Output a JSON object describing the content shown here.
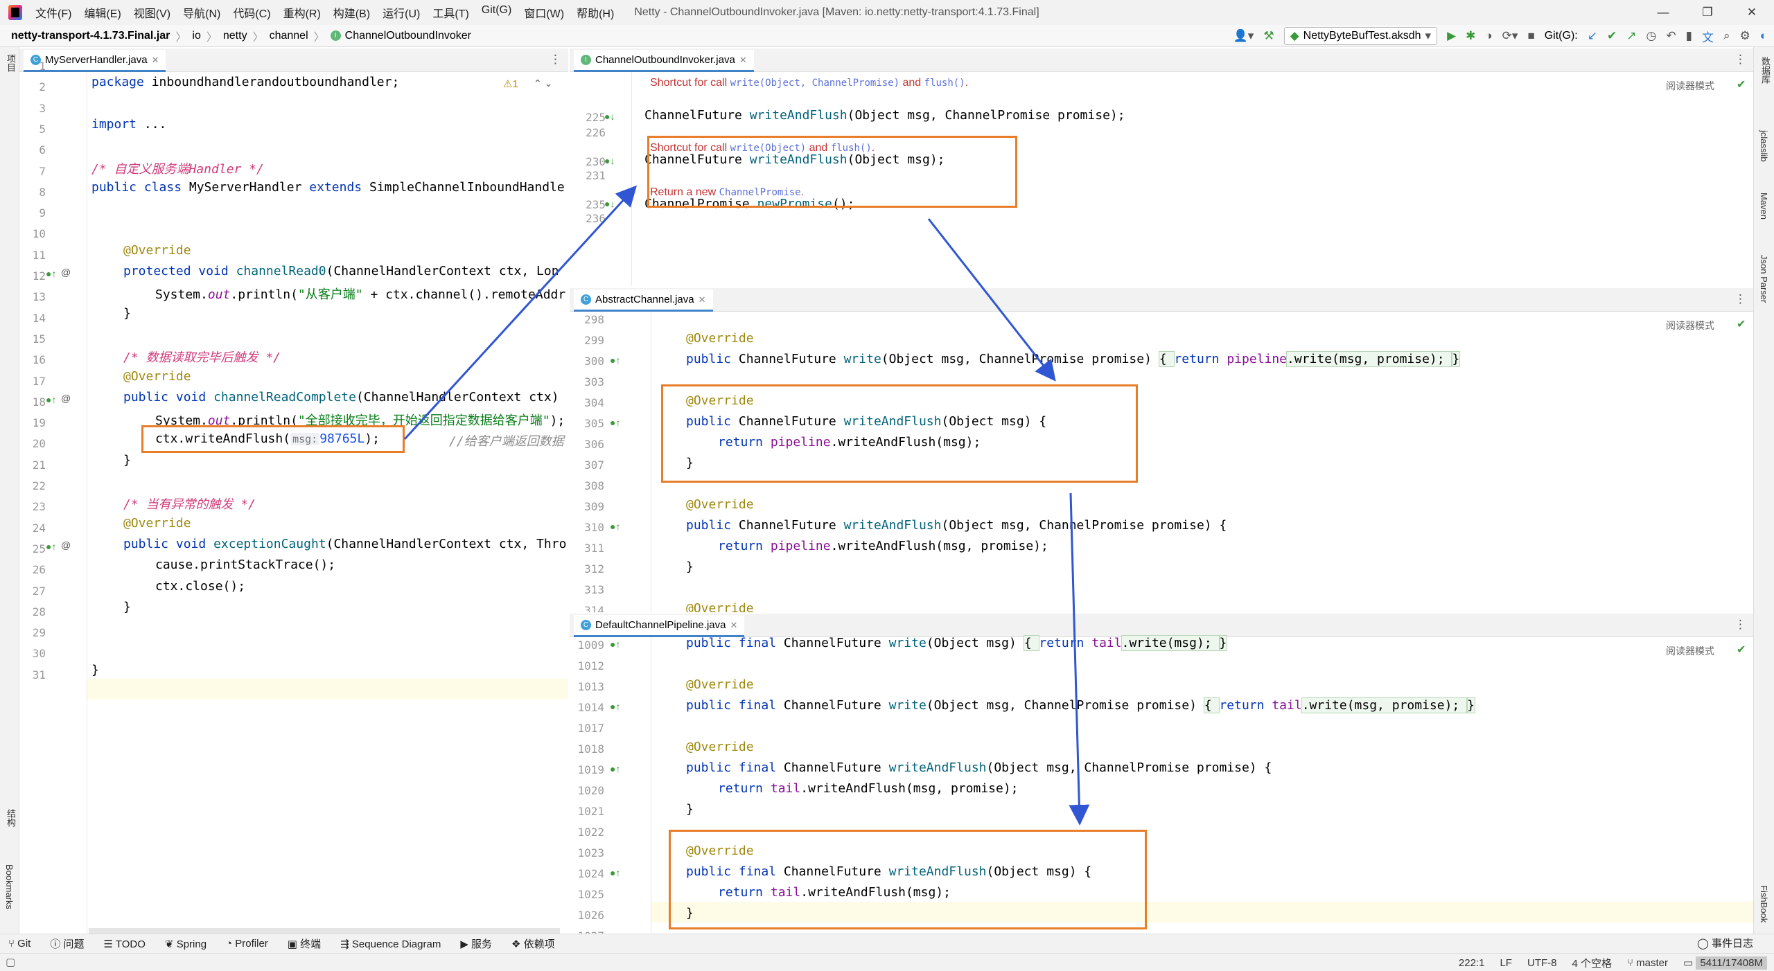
{
  "menus": [
    "文件(F)",
    "编辑(E)",
    "视图(V)",
    "导航(N)",
    "代码(C)",
    "重构(R)",
    "构建(B)",
    "运行(U)",
    "工具(T)",
    "Git(G)",
    "窗口(W)",
    "帮助(H)"
  ],
  "window_title": "Netty - ChannelOutboundInvoker.java [Maven: io.netty:netty-transport:4.1.73.Final]",
  "window_controls": [
    "—",
    "❐",
    "✕"
  ],
  "breadcrumbs": [
    "netty-transport-4.1.73.Final.jar",
    "io",
    "netty",
    "channel",
    "ChannelOutboundInvoker"
  ],
  "run_config": "NettyByteBufTest.aksdh",
  "git_label": "Git(G):",
  "left_tools": [
    "项目",
    "结构",
    "Bookmarks"
  ],
  "right_tools": [
    "数据库",
    "jclasslib",
    "Maven",
    "Json Parser",
    "FishBook"
  ],
  "reader_mode": "阅读器模式",
  "left_editor": {
    "tab": "MyServerHandler.java",
    "warning": "⚠1",
    "lines": [
      "1",
      "2",
      "3",
      "5",
      "6",
      "7",
      "8",
      "9",
      "10",
      "11",
      "12",
      "13",
      "14",
      "15",
      "16",
      "17",
      "18",
      "19",
      "20",
      "21",
      "22",
      "23",
      "24",
      "25",
      "26",
      "27",
      "28",
      "29",
      "30",
      "31"
    ],
    "code": {
      "l1_kw": "package",
      "l1_rest": " inboundhandlerandoutboundhandler;",
      "l3_kw": "import",
      "l3_rest": " ...",
      "l6": "/* 自定义服务端Handler */",
      "l7_a": "public class",
      "l7_b": " MyServerHandler ",
      "l7_c": "extends",
      "l7_d": " SimpleChannelInboundHandle",
      "override": "@Override",
      "l11_a": "protected void",
      "l11_b": "channelRead0",
      "l11_c": "(ChannelHandlerContext ctx, Lon",
      "l12_a": "System.",
      "l12_b": "out",
      "l12_c": ".println(",
      "l12_d": "\"从客户端\"",
      "l12_e": " + ctx.channel().remoteAddr",
      "l15": "/* 数据读取完毕后触发 */",
      "l17_a": "public void",
      "l17_b": "channelReadComplete",
      "l17_c": "(ChannelHandlerContext ctx)",
      "l18_d": "\"全部接收完毕，开始返回指定数据给客户端\"",
      "l18_e": ");",
      "l19_a": "ctx.writeAndFlush(",
      "l19_hint": "msg:",
      "l19_val": "98765L",
      "l19_b": ");",
      "l19_cm": "//给客户端返回数据",
      "brace_close": "}",
      "l22": "/* 当有异常的触发 */",
      "l24_a": "public void",
      "l24_b": "exceptionCaught",
      "l24_c": "(ChannelHandlerContext ctx, Thro",
      "l25": "cause.printStackTrace();",
      "l26": "ctx.close();"
    }
  },
  "top_editor": {
    "tab": "ChannelOutboundInvoker.java",
    "lines": [
      "225",
      "226",
      "230",
      "231",
      "235",
      "236"
    ],
    "doc1_a": "Shortcut for call ",
    "doc1_b": "write(Object, ChannelPromise)",
    "doc1_c": " and ",
    "doc1_d": "flush()",
    "doc1_e": ".",
    "m225_a": "ChannelFuture ",
    "m225_b": "writeAndFlush",
    "m225_c": "(Object msg, ChannelPromise promise);",
    "doc2_a": "Shortcut for call ",
    "doc2_b": "write(Object)",
    "doc2_c": " and ",
    "doc2_d": "flush()",
    "doc2_e": ".",
    "m230_c": "(Object msg);",
    "doc3_a": "Return a new ",
    "doc3_b": "ChannelPromise",
    "doc3_c": ".",
    "m235_a": "ChannelPromise ",
    "m235_b": "newPromise",
    "m235_c": "();"
  },
  "mid_editor": {
    "tab": "AbstractChannel.java",
    "lines": [
      "298",
      "299",
      "300",
      "303",
      "304",
      "305",
      "306",
      "307",
      "308",
      "309",
      "310",
      "311",
      "312",
      "313",
      "314"
    ],
    "override": "@Override",
    "pubcf": "public",
    "cf": " ChannelFuture ",
    "write": "write",
    "waf": "writeAndFlush",
    "ret": "return",
    "pipeline": "pipeline",
    "l300_c": "(Object msg, ChannelPromise promise) ",
    "l300_d": "{ ",
    "l300_e": ".write(msg, promise); ",
    "l300_f": "}",
    "l305_c": "(Object msg) {",
    "l306_c": ".writeAndFlush(msg);",
    "close": "}",
    "l310_c": "(Object msg, ChannelPromise promise) {",
    "l311_c": ".writeAndFlush(msg, promise);",
    "l314": "@Override"
  },
  "bot_editor": {
    "tab": "DefaultChannelPipeline.java",
    "lines": [
      "1009",
      "1012",
      "1013",
      "1014",
      "1017",
      "1018",
      "1019",
      "1020",
      "1021",
      "1022",
      "1023",
      "1024",
      "1025",
      "1026",
      "1027"
    ],
    "override": "@Override",
    "pubfinal": "public final",
    "cf": " ChannelFuture ",
    "write": "write",
    "waf": "writeAndFlush",
    "ret": "return",
    "tail": "tail",
    "l1009_c": "(Object msg) ",
    "l1009_d": "{ ",
    "l1009_e": ".write(msg); ",
    "l1009_f": "}",
    "l1014_c": "(Object msg, ChannelPromise promise) ",
    "l1014_e": ".write(msg, promise); ",
    "l1019_c": "(Object msg, ChannelPromise promise) {",
    "l1020_c": ".writeAndFlush(msg, promise);",
    "close": "}",
    "l1024_c": "(Object msg) {",
    "l1025_c": ".writeAndFlush(msg);"
  },
  "bottom_tools": [
    "Git",
    "问题",
    "TODO",
    "Spring",
    "Profiler",
    "终端",
    "Sequence Diagram",
    "服务",
    "依赖项"
  ],
  "event_log": "事件日志",
  "status": {
    "pos": "222:1",
    "le": "LF",
    "enc": "UTF-8",
    "indent": "4 个空格",
    "branch": "master",
    "memory": "5411/17408M"
  },
  "colors": {
    "accent_box": "#e87d2a",
    "arrow": "#3056d3",
    "tab_underline": "#4083c9"
  }
}
